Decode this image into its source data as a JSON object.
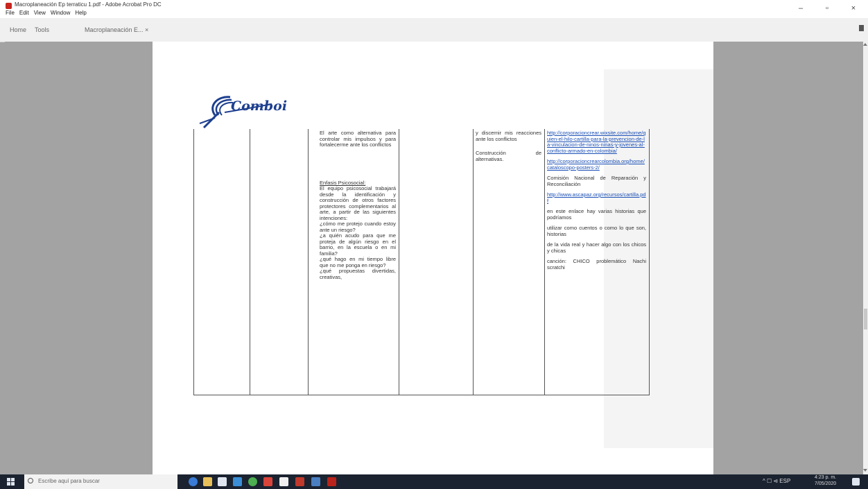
{
  "window": {
    "title": "Macroplaneación Ep terraticu 1.pdf - Adobe Acrobat Pro DC",
    "menus": [
      "File",
      "Edit",
      "View",
      "Window",
      "Help"
    ],
    "minimize": "–",
    "maximize": "▫",
    "close": "×"
  },
  "tabs": {
    "home": "Home",
    "tools": "Tools",
    "document": "Macroplaneación E... ×"
  },
  "document": {
    "logo_text": "Comboi",
    "col_activity": [
      "El arte como alternativa para controlar mis impulsos y para fortalecerme ante los conflictos",
      "Enfasis Psicosocial:",
      "El equipo psicosocial trabajará desde la identificación y construcción de otros factores protectores complementarios al arte, a partir de las siguientes intenciones:",
      "¿cómo me protejo cuando estoy ante un riesgo?",
      "¿a quién acudo para que me proteja de algún riesgo en el barrio, en la escuela o en mi familia?",
      "¿qué hago en mi tiempo libre que no me ponga en riesgo?",
      "¿qué propuestas divertidas, creativas,"
    ],
    "col_outcome": [
      "y discernir mis reacciones ante los conflictos",
      "Construcción de alternativas."
    ],
    "col_resources": {
      "link1": "http://corporacioncrear.wixsite.com/home/quien-el-hilo-cartilla-para-la-prevencion-de-la-vinculacion-de-ninos-ninas-y-jovenes-al-conflicto-armado-en-colombia/",
      "link2": "http://corporacioncrearcolombia.org/home/cataloscopo-posters-2/",
      "text1": "Comisión Nacional de Reparación y Reconciliación",
      "link3": "http://www.ascapaz.org/recursos/cartilla.pdf",
      "text2": "en este enlace hay varias historias que podríamos",
      "text3": "utilizar como cuentos o como lo que son, historias",
      "text4": "de la vida real y hacer algo con los chicos y chicas",
      "text5": "canción: CHICO problemático Nachi scratchi"
    }
  },
  "taskbar": {
    "search_placeholder": "Escribe aquí para buscar",
    "tray_left": "^ ☐ ⊲ ESP",
    "time": "4:23 p. m.",
    "date": "7/05/2020"
  },
  "colors": {
    "acrobat_red": "#c8251e",
    "link_blue": "#1a4fb5",
    "taskbar_bg": "#1b2330",
    "viewport_gray": "#a3a3a3"
  }
}
